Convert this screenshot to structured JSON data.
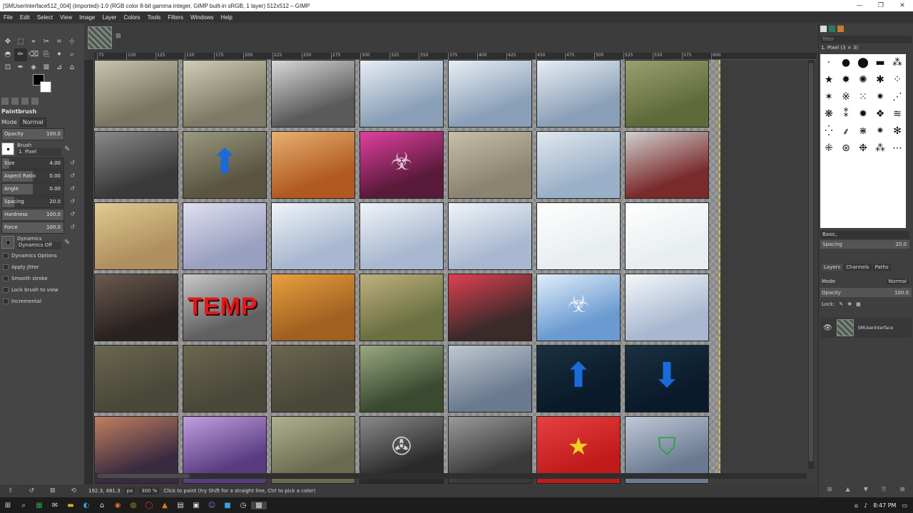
{
  "window": {
    "title": "[SMUserInterface512_004] (imported)-1.0 (RGB color 8-bit gamma integer, GIMP built-in sRGB, 1 layer) 512x512 – GIMP",
    "minimize": "—",
    "maximize": "❐",
    "close": "✕"
  },
  "menu": [
    "File",
    "Edit",
    "Select",
    "View",
    "Image",
    "Layer",
    "Colors",
    "Tools",
    "Filters",
    "Windows",
    "Help"
  ],
  "toolbox": {
    "tools": [
      "✥",
      "⬚",
      "⌖",
      "✂",
      "⌗",
      "⊹",
      "◓",
      "✏",
      "⌫",
      "⎘",
      "✦",
      "⌕",
      "⊡",
      "✒",
      "◈",
      "⊠",
      "⊿",
      "⌂"
    ],
    "active_tool_index": 7
  },
  "tool_options": {
    "title": "Paintbrush",
    "mode_label": "Mode",
    "mode_value": "Normal",
    "opacity": {
      "label": "Opacity",
      "value": "100.0",
      "fraction": 1.0
    },
    "brush_label": "Brush",
    "brush_name": "1. Pixel",
    "size": {
      "label": "Size",
      "value": "4.00",
      "fraction": 0.12
    },
    "aspect": {
      "label": "Aspect Ratio",
      "value": "0.00",
      "fraction": 0.5
    },
    "angle": {
      "label": "Angle",
      "value": "0.00",
      "fraction": 0.5
    },
    "spacing": {
      "label": "Spacing",
      "value": "20.0",
      "fraction": 0.2
    },
    "hardness": {
      "label": "Hardness",
      "value": "100.0",
      "fraction": 1.0
    },
    "force": {
      "label": "Force",
      "value": "100.0",
      "fraction": 1.0
    },
    "dynamics_label": "Dynamics",
    "dynamics_value": "Dynamics Off",
    "checkboxes": [
      "Dynamics Options",
      "Apply Jitter",
      "Smooth stroke",
      "Lock brush to view",
      "Incremental"
    ]
  },
  "ruler": [
    "75",
    "100",
    "125",
    "150",
    "175",
    "200",
    "225",
    "250",
    "275",
    "300",
    "325",
    "350",
    "375",
    "400",
    "425",
    "450",
    "475",
    "500",
    "525",
    "550",
    "575",
    "600"
  ],
  "tiles": [
    {
      "c1": "#7a7560",
      "c2": "#c9c4b0",
      "g": ""
    },
    {
      "c1": "#7e7a66",
      "c2": "#d0ccb5",
      "g": ""
    },
    {
      "c1": "#5a5a5a",
      "c2": "#d8d8d8",
      "g": ""
    },
    {
      "c1": "#8aa0b8",
      "c2": "#e8eef4",
      "g": ""
    },
    {
      "c1": "#8aa0b8",
      "c2": "#e8eef4",
      "g": ""
    },
    {
      "c1": "#8aa0b8",
      "c2": "#e8eef4",
      "g": ""
    },
    {
      "c1": "#5f6a3a",
      "c2": "#9aa070",
      "g": ""
    },
    {
      "c1": "#3a3a3a",
      "c2": "#8a8a8a",
      "g": ""
    },
    {
      "c1": "#5a5440",
      "c2": "#9a9a80",
      "g": "⬆"
    },
    {
      "c1": "#b05a20",
      "c2": "#e8b070",
      "g": ""
    },
    {
      "c1": "#5a1a3a",
      "c2": "#e040a0",
      "g": "☣"
    },
    {
      "c1": "#8a8470",
      "c2": "#c8bfa8",
      "g": ""
    },
    {
      "c1": "#9ab0c8",
      "c2": "#e0e8ee",
      "g": ""
    },
    {
      "c1": "#7a2a2a",
      "c2": "#d0d0d0",
      "g": ""
    },
    {
      "c1": "#b09060",
      "c2": "#e0cc90",
      "g": ""
    },
    {
      "c1": "#9aa0c0",
      "c2": "#e0e0f0",
      "g": ""
    },
    {
      "c1": "#a8b8d0",
      "c2": "#f0f4f8",
      "g": ""
    },
    {
      "c1": "#a8b8d0",
      "c2": "#f0f4f8",
      "g": ""
    },
    {
      "c1": "#a8b8d0",
      "c2": "#f0f4f8",
      "g": ""
    },
    {
      "c1": "#e8eef0",
      "c2": "#ffffff",
      "g": ""
    },
    {
      "c1": "#e8eef0",
      "c2": "#ffffff",
      "g": ""
    },
    {
      "c1": "#2a2220",
      "c2": "#6a5a50",
      "g": ""
    },
    {
      "c1": "#606060",
      "c2": "#c8c8c8",
      "g": "TEMP"
    },
    {
      "c1": "#a06020",
      "c2": "#e8a040",
      "g": ""
    },
    {
      "c1": "#6a7040",
      "c2": "#c0b080",
      "g": ""
    },
    {
      "c1": "#3a2a2a",
      "c2": "#e04050",
      "g": ""
    },
    {
      "c1": "#6a9ad0",
      "c2": "#e0eefa",
      "g": "☣"
    },
    {
      "c1": "#a8b8d0",
      "c2": "#f4f8fa",
      "g": ""
    },
    {
      "c1": "#4a4838",
      "c2": "#6a6650",
      "g": ""
    },
    {
      "c1": "#4a4838",
      "c2": "#6a6650",
      "g": ""
    },
    {
      "c1": "#4a4838",
      "c2": "#6a6650",
      "g": ""
    },
    {
      "c1": "#3a4a30",
      "c2": "#9aa880",
      "g": ""
    },
    {
      "c1": "#6a7a90",
      "c2": "#c0c8d0",
      "g": ""
    },
    {
      "c1": "#0a1a2a",
      "c2": "#1a3040",
      "g": "⬆"
    },
    {
      "c1": "#0a1a2a",
      "c2": "#1a3040",
      "g": "⬇"
    },
    {
      "c1": "#3a2a40",
      "c2": "#c08060",
      "g": ""
    },
    {
      "c1": "#5a3a80",
      "c2": "#c0a0e0",
      "g": ""
    },
    {
      "c1": "#6a6a50",
      "c2": "#b0b090",
      "g": ""
    },
    {
      "c1": "#2a2a2a",
      "c2": "#8a8a8a",
      "g": "✇"
    },
    {
      "c1": "#3a3a3a",
      "c2": "#9a9a9a",
      "g": ""
    },
    {
      "c1": "#c01a1a",
      "c2": "#e84040",
      "g": "★"
    },
    {
      "c1": "#6a7a90",
      "c2": "#c0c8d8",
      "g": "⛉"
    }
  ],
  "statusbar": {
    "coords": "192.3, 481.3",
    "unit": "px",
    "zoom": "300 %",
    "message": "Click to paint (try Shift for a straight line, Ctrl to pick a color)"
  },
  "dock": {
    "filter_placeholder": "filter",
    "brush_name": "1. Pixel (3 × 3)",
    "brushes": [
      "·",
      "●",
      "⬤",
      "▬",
      "⁂",
      "★",
      "✸",
      "✺",
      "✱",
      "⁘",
      "✶",
      "※",
      "⁙",
      "✷",
      "⋰",
      "❋",
      "⁑",
      "✹",
      "❖",
      "≋",
      "⁛",
      "⸙",
      "⋇",
      "⁕",
      "✻",
      "⁜",
      "⊛",
      "❉",
      "⁂",
      "⋯"
    ],
    "preset": "Basic,",
    "spacing_label": "Spacing",
    "spacing_value": "20.0",
    "tabs": [
      "Layers",
      "Channels",
      "Paths"
    ],
    "mode_label": "Mode",
    "mode_value": "Normal",
    "opacity_label": "Opacity",
    "opacity_value": "100.0",
    "lock_label": "Lock:",
    "layer_name": "SMUserInterface"
  },
  "taskbar": {
    "time": "8:47 PM"
  }
}
